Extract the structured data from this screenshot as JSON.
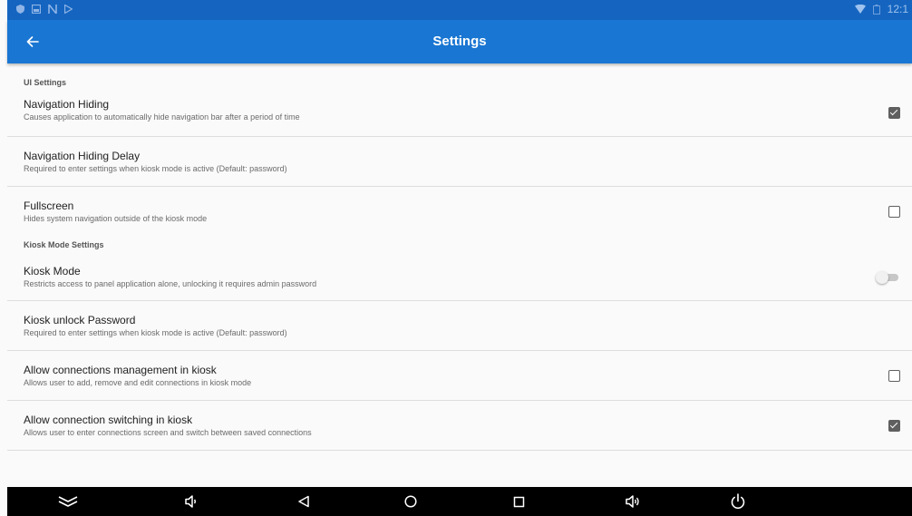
{
  "statusbar": {
    "time": "12:1"
  },
  "appbar": {
    "title": "Settings"
  },
  "sections": [
    {
      "header": "UI Settings",
      "items": [
        {
          "title": "Navigation Hiding",
          "summary": "Causes application to automatically hide navigation bar after a period of time",
          "control": "checkbox",
          "checked": true
        },
        {
          "title": "Navigation Hiding Delay",
          "summary": "Required to enter settings when kiosk mode is active (Default: password)",
          "control": "none"
        },
        {
          "title": "Fullscreen",
          "summary": "Hides system navigation outside of the kiosk mode",
          "control": "checkbox",
          "checked": false
        }
      ]
    },
    {
      "header": "Kiosk Mode Settings",
      "items": [
        {
          "title": "Kiosk Mode",
          "summary": "Restricts access to panel application alone, unlocking it requires admin password",
          "control": "switch",
          "checked": false
        },
        {
          "title": "Kiosk unlock Password",
          "summary": "Required to enter settings when kiosk mode is active (Default: password)",
          "control": "none"
        },
        {
          "title": "Allow connections management in kiosk",
          "summary": "Allows user to add, remove and edit connections in kiosk mode",
          "control": "checkbox",
          "checked": false
        },
        {
          "title": "Allow connection switching in kiosk",
          "summary": "Allows user to enter connections screen and switch between saved connections",
          "control": "checkbox",
          "checked": true
        }
      ]
    }
  ],
  "navbar": {
    "buttons": [
      "hide-nav-icon",
      "volume-down-icon",
      "back-icon",
      "home-icon",
      "recents-icon",
      "volume-up-icon",
      "power-icon"
    ]
  },
  "colors": {
    "appbar": "#1976d2",
    "statusbar": "#1565c0",
    "background": "#fafafa",
    "navbar": "#000000"
  }
}
